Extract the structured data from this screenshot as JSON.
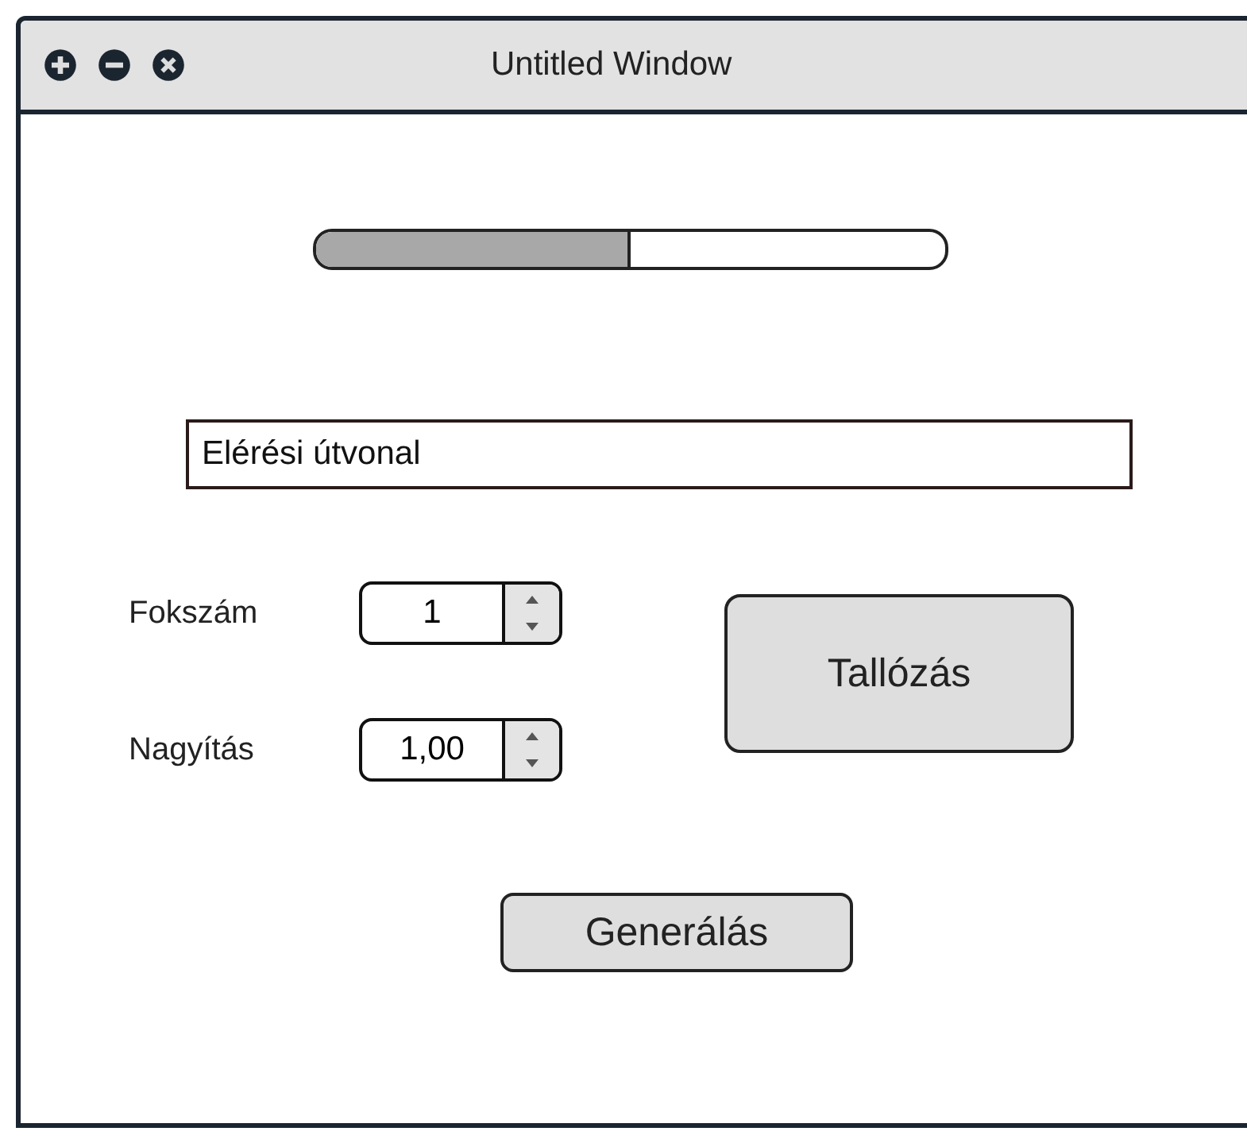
{
  "window": {
    "title": "Untitled Window"
  },
  "progress": {
    "level": 0.5
  },
  "path_field": {
    "value": "Elérési útvonal"
  },
  "spinners": [
    {
      "label": "Fokszám",
      "value": "1"
    },
    {
      "label": "Nagyítás",
      "value": "1,00"
    }
  ],
  "buttons": [
    {
      "kind": "browse",
      "label": "Tallózás"
    },
    {
      "kind": "generate",
      "label": "Generálás"
    }
  ]
}
